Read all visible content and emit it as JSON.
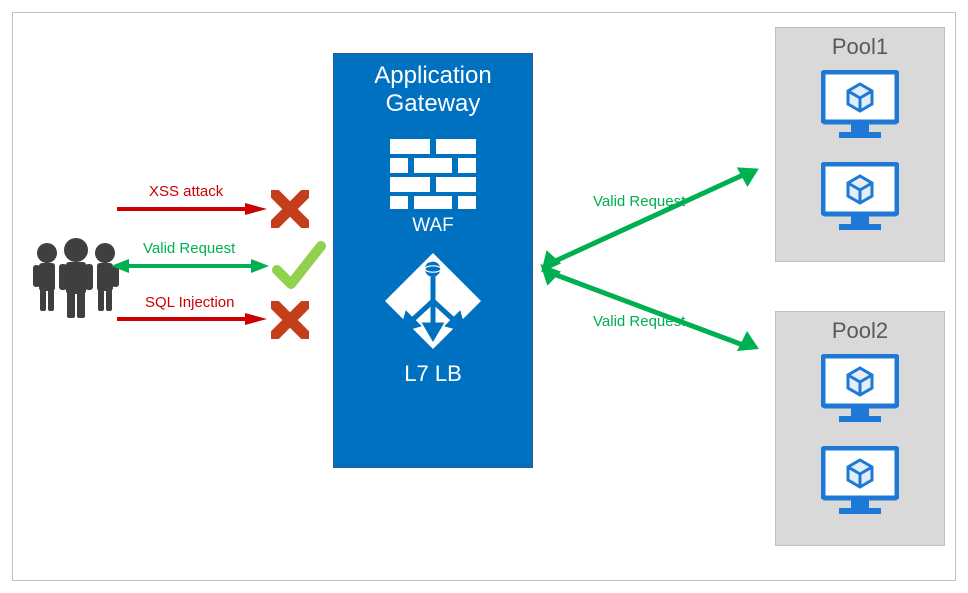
{
  "gateway": {
    "title_line1": "Application",
    "title_line2": "Gateway",
    "waf_label": "WAF",
    "lb_label": "L7 LB"
  },
  "pool1": {
    "title": "Pool1"
  },
  "pool2": {
    "title": "Pool2"
  },
  "labels": {
    "xss": "XSS attack",
    "valid_request": "Valid Request",
    "sql_injection": "SQL Injection",
    "valid_request_top": "Valid Request",
    "valid_request_bottom": "Valid Request"
  },
  "colors": {
    "gateway_bg": "#0070c0",
    "pool_bg": "#d9d9d9",
    "green": "#00b050",
    "red": "#cc0000",
    "azure_blue": "#1e78d6",
    "people": "#3f3f3f",
    "x_color": "#c43e1c",
    "check_color": "#92d050"
  }
}
